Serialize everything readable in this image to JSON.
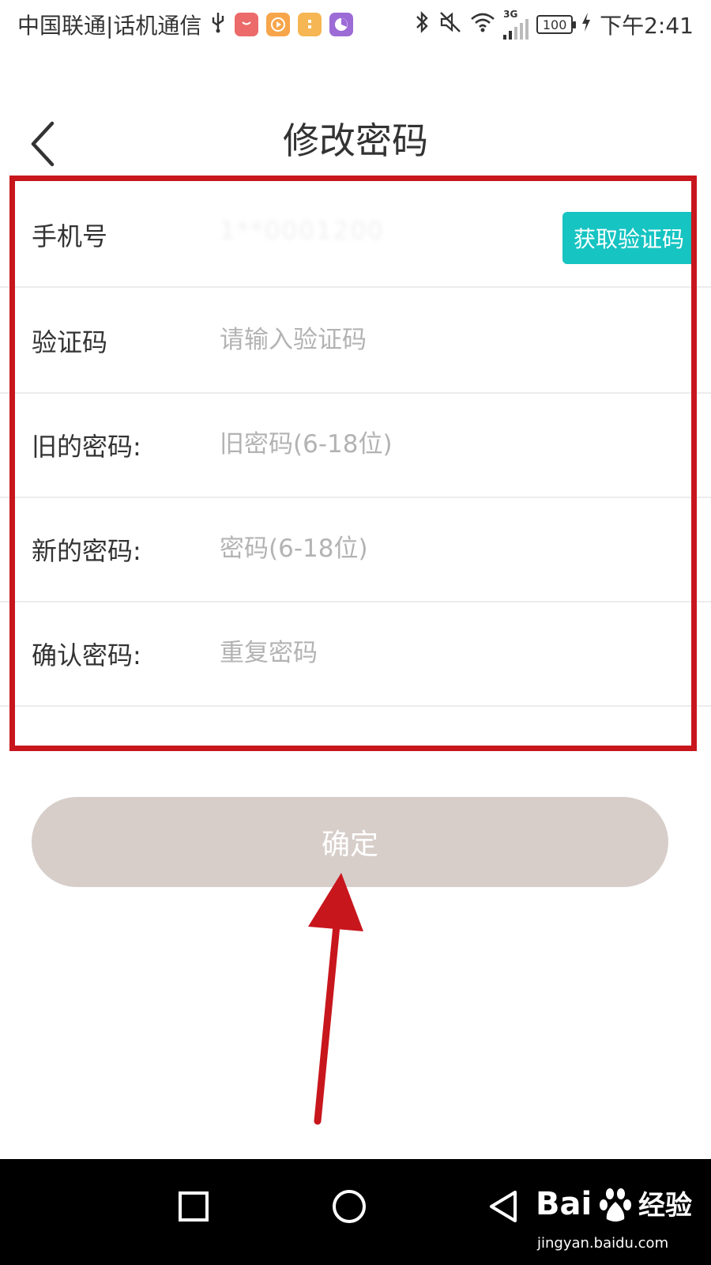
{
  "status_bar": {
    "carrier": "中国联通|话机通信",
    "network": "3G",
    "battery": "100",
    "time": "下午2:41",
    "icons": [
      "usb-icon",
      "huawei-store-icon",
      "video-app-icon",
      "orange-app-icon",
      "purple-app-icon",
      "bluetooth-icon",
      "mute-icon",
      "wifi-icon",
      "signal-icon",
      "charging-icon"
    ]
  },
  "header": {
    "title": "修改密码",
    "back_icon": "chevron-left-icon"
  },
  "form": {
    "phone": {
      "label": "手机号",
      "value": "1**0001200",
      "button": "获取验证码"
    },
    "code": {
      "label": "验证码",
      "placeholder": "请输入验证码"
    },
    "old_password": {
      "label": "旧的密码:",
      "placeholder": "旧密码(6-18位)"
    },
    "new_password": {
      "label": "新的密码:",
      "placeholder": "密码(6-18位)"
    },
    "confirm_password": {
      "label": "确认密码:",
      "placeholder": "重复密码"
    }
  },
  "confirm_button": "确定",
  "nav_bar": {
    "watermark_sub": "jingyan.baidu.com"
  },
  "colors": {
    "accent_teal": "#16c4c2",
    "confirm_button_bg": "#d7ceca",
    "annotation_red": "#c8161d"
  }
}
